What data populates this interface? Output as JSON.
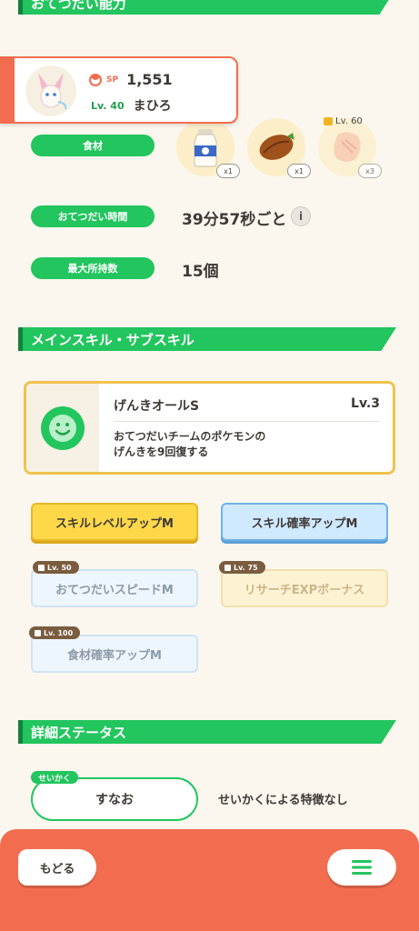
{
  "sections": {
    "helping_ability": "おてつだい能力",
    "main_sub_skill": "メインスキル・サブスキル",
    "detail_status": "詳細ステータス"
  },
  "pokemon_card": {
    "sp_label": "SP",
    "sp_value": "1,551",
    "level": "Lv. 40",
    "name": "まひろ",
    "icon": "sylveon-icon"
  },
  "ingredients": {
    "label": "食材",
    "items": [
      {
        "icon": "moomoo-milk-icon",
        "count": "x1"
      },
      {
        "icon": "cacao-icon",
        "count": "x1"
      },
      {
        "icon": "locked-ingredient-icon",
        "count": "x3",
        "unlock_level": "Lv. 60"
      }
    ]
  },
  "helping_time": {
    "label": "おてつだい時間",
    "value": "39分57秒ごと",
    "info_icon": "i"
  },
  "max_carry": {
    "label": "最大所持数",
    "value": "15個"
  },
  "main_skill": {
    "name": "げんきオールS",
    "level": "Lv.3",
    "description_line1": "おてつだいチームのポケモンの",
    "description_line2": "げんきを9回復する",
    "icon": "smile-icon"
  },
  "sub_skills": [
    {
      "label": "スキルレベルアップM",
      "locked": false,
      "color": "#ffd84a"
    },
    {
      "label": "スキル確率アップM",
      "locked": false,
      "color": "#cfe9ff"
    },
    {
      "label": "おてつだいスピードM",
      "locked": true,
      "unlock": "Lv. 50"
    },
    {
      "label": "リサーチEXPボーナス",
      "locked": true,
      "unlock": "Lv. 75"
    },
    {
      "label": "食材確率アップM",
      "locked": true,
      "unlock": "Lv. 100"
    }
  ],
  "nature": {
    "tag": "せいかく",
    "value": "すなお",
    "effect": "せいかくによる特徴なし"
  },
  "bottom_bar": {
    "back_label": "もどる",
    "menu_icon": "hamburger-menu-icon"
  },
  "colors": {
    "accent_green": "#22c55e",
    "accent_orange": "#f26d4f",
    "skill_yellow": "#ffd84a",
    "skill_blue": "#cfe9ff",
    "background": "#fbf7ee"
  }
}
